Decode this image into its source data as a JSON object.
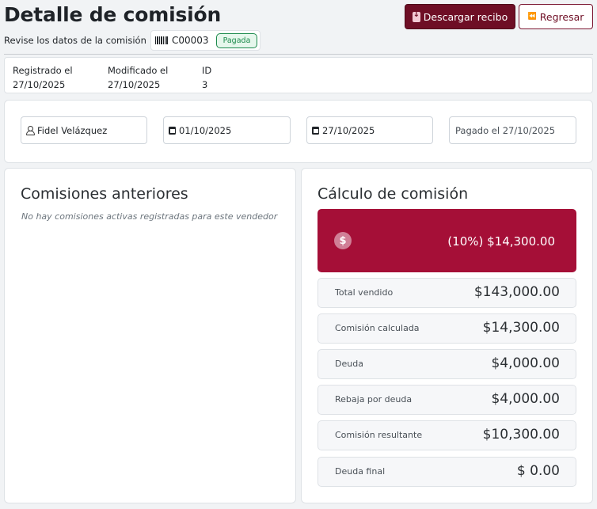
{
  "header": {
    "title": "Detalle de comisión",
    "subtitle": "Revise los datos de la comisión",
    "code": "C00003",
    "status": "Pagada",
    "download_label": "Descargar recibo",
    "back_label": "Regresar",
    "back_icon": "⏪"
  },
  "meta": {
    "registered_label": "Registrado el",
    "registered_value": "27/10/2025",
    "modified_label": "Modificado el",
    "modified_value": "27/10/2025",
    "id_label": "ID",
    "id_value": "3"
  },
  "filters": {
    "seller": "Fidel Velázquez",
    "start_date": "01/10/2025",
    "end_date": "27/10/2025",
    "paid": "Pagado el 27/10/2025"
  },
  "previous": {
    "title": "Comisiones anteriores",
    "empty": "No hay comisiones activas registradas para este vendedor"
  },
  "calc": {
    "title": "Cálculo de comisión",
    "dollar_symbol": "$",
    "highlight": "(10%) $14,300.00",
    "rows": [
      {
        "label": "Total vendido",
        "value": "$143,000.00"
      },
      {
        "label": "Comisión calculada",
        "value": "$14,300.00"
      },
      {
        "label": "Deuda",
        "value": "$4,000.00"
      },
      {
        "label": "Rebaja por deuda",
        "value": "$4,000.00"
      },
      {
        "label": "Comisión resultante",
        "value": "$10,300.00"
      },
      {
        "label": "Deuda final",
        "value": "$ 0.00"
      }
    ]
  },
  "colors": {
    "brand": "#6e0e25",
    "highlight": "#a50f37",
    "badge_green": "#1c8a4c"
  }
}
